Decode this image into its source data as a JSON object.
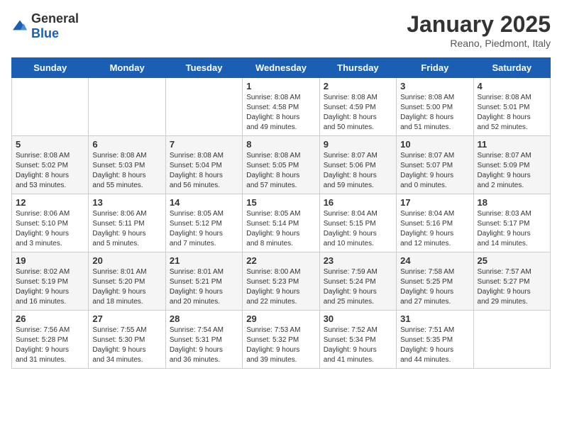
{
  "logo": {
    "general": "General",
    "blue": "Blue"
  },
  "header": {
    "month_year": "January 2025",
    "location": "Reano, Piedmont, Italy"
  },
  "weekdays": [
    "Sunday",
    "Monday",
    "Tuesday",
    "Wednesday",
    "Thursday",
    "Friday",
    "Saturday"
  ],
  "weeks": [
    [
      {
        "day": "",
        "info": ""
      },
      {
        "day": "",
        "info": ""
      },
      {
        "day": "",
        "info": ""
      },
      {
        "day": "1",
        "info": "Sunrise: 8:08 AM\nSunset: 4:58 PM\nDaylight: 8 hours\nand 49 minutes."
      },
      {
        "day": "2",
        "info": "Sunrise: 8:08 AM\nSunset: 4:59 PM\nDaylight: 8 hours\nand 50 minutes."
      },
      {
        "day": "3",
        "info": "Sunrise: 8:08 AM\nSunset: 5:00 PM\nDaylight: 8 hours\nand 51 minutes."
      },
      {
        "day": "4",
        "info": "Sunrise: 8:08 AM\nSunset: 5:01 PM\nDaylight: 8 hours\nand 52 minutes."
      }
    ],
    [
      {
        "day": "5",
        "info": "Sunrise: 8:08 AM\nSunset: 5:02 PM\nDaylight: 8 hours\nand 53 minutes."
      },
      {
        "day": "6",
        "info": "Sunrise: 8:08 AM\nSunset: 5:03 PM\nDaylight: 8 hours\nand 55 minutes."
      },
      {
        "day": "7",
        "info": "Sunrise: 8:08 AM\nSunset: 5:04 PM\nDaylight: 8 hours\nand 56 minutes."
      },
      {
        "day": "8",
        "info": "Sunrise: 8:08 AM\nSunset: 5:05 PM\nDaylight: 8 hours\nand 57 minutes."
      },
      {
        "day": "9",
        "info": "Sunrise: 8:07 AM\nSunset: 5:06 PM\nDaylight: 8 hours\nand 59 minutes."
      },
      {
        "day": "10",
        "info": "Sunrise: 8:07 AM\nSunset: 5:07 PM\nDaylight: 9 hours\nand 0 minutes."
      },
      {
        "day": "11",
        "info": "Sunrise: 8:07 AM\nSunset: 5:09 PM\nDaylight: 9 hours\nand 2 minutes."
      }
    ],
    [
      {
        "day": "12",
        "info": "Sunrise: 8:06 AM\nSunset: 5:10 PM\nDaylight: 9 hours\nand 3 minutes."
      },
      {
        "day": "13",
        "info": "Sunrise: 8:06 AM\nSunset: 5:11 PM\nDaylight: 9 hours\nand 5 minutes."
      },
      {
        "day": "14",
        "info": "Sunrise: 8:05 AM\nSunset: 5:12 PM\nDaylight: 9 hours\nand 7 minutes."
      },
      {
        "day": "15",
        "info": "Sunrise: 8:05 AM\nSunset: 5:14 PM\nDaylight: 9 hours\nand 8 minutes."
      },
      {
        "day": "16",
        "info": "Sunrise: 8:04 AM\nSunset: 5:15 PM\nDaylight: 9 hours\nand 10 minutes."
      },
      {
        "day": "17",
        "info": "Sunrise: 8:04 AM\nSunset: 5:16 PM\nDaylight: 9 hours\nand 12 minutes."
      },
      {
        "day": "18",
        "info": "Sunrise: 8:03 AM\nSunset: 5:17 PM\nDaylight: 9 hours\nand 14 minutes."
      }
    ],
    [
      {
        "day": "19",
        "info": "Sunrise: 8:02 AM\nSunset: 5:19 PM\nDaylight: 9 hours\nand 16 minutes."
      },
      {
        "day": "20",
        "info": "Sunrise: 8:01 AM\nSunset: 5:20 PM\nDaylight: 9 hours\nand 18 minutes."
      },
      {
        "day": "21",
        "info": "Sunrise: 8:01 AM\nSunset: 5:21 PM\nDaylight: 9 hours\nand 20 minutes."
      },
      {
        "day": "22",
        "info": "Sunrise: 8:00 AM\nSunset: 5:23 PM\nDaylight: 9 hours\nand 22 minutes."
      },
      {
        "day": "23",
        "info": "Sunrise: 7:59 AM\nSunset: 5:24 PM\nDaylight: 9 hours\nand 25 minutes."
      },
      {
        "day": "24",
        "info": "Sunrise: 7:58 AM\nSunset: 5:25 PM\nDaylight: 9 hours\nand 27 minutes."
      },
      {
        "day": "25",
        "info": "Sunrise: 7:57 AM\nSunset: 5:27 PM\nDaylight: 9 hours\nand 29 minutes."
      }
    ],
    [
      {
        "day": "26",
        "info": "Sunrise: 7:56 AM\nSunset: 5:28 PM\nDaylight: 9 hours\nand 31 minutes."
      },
      {
        "day": "27",
        "info": "Sunrise: 7:55 AM\nSunset: 5:30 PM\nDaylight: 9 hours\nand 34 minutes."
      },
      {
        "day": "28",
        "info": "Sunrise: 7:54 AM\nSunset: 5:31 PM\nDaylight: 9 hours\nand 36 minutes."
      },
      {
        "day": "29",
        "info": "Sunrise: 7:53 AM\nSunset: 5:32 PM\nDaylight: 9 hours\nand 39 minutes."
      },
      {
        "day": "30",
        "info": "Sunrise: 7:52 AM\nSunset: 5:34 PM\nDaylight: 9 hours\nand 41 minutes."
      },
      {
        "day": "31",
        "info": "Sunrise: 7:51 AM\nSunset: 5:35 PM\nDaylight: 9 hours\nand 44 minutes."
      },
      {
        "day": "",
        "info": ""
      }
    ]
  ]
}
